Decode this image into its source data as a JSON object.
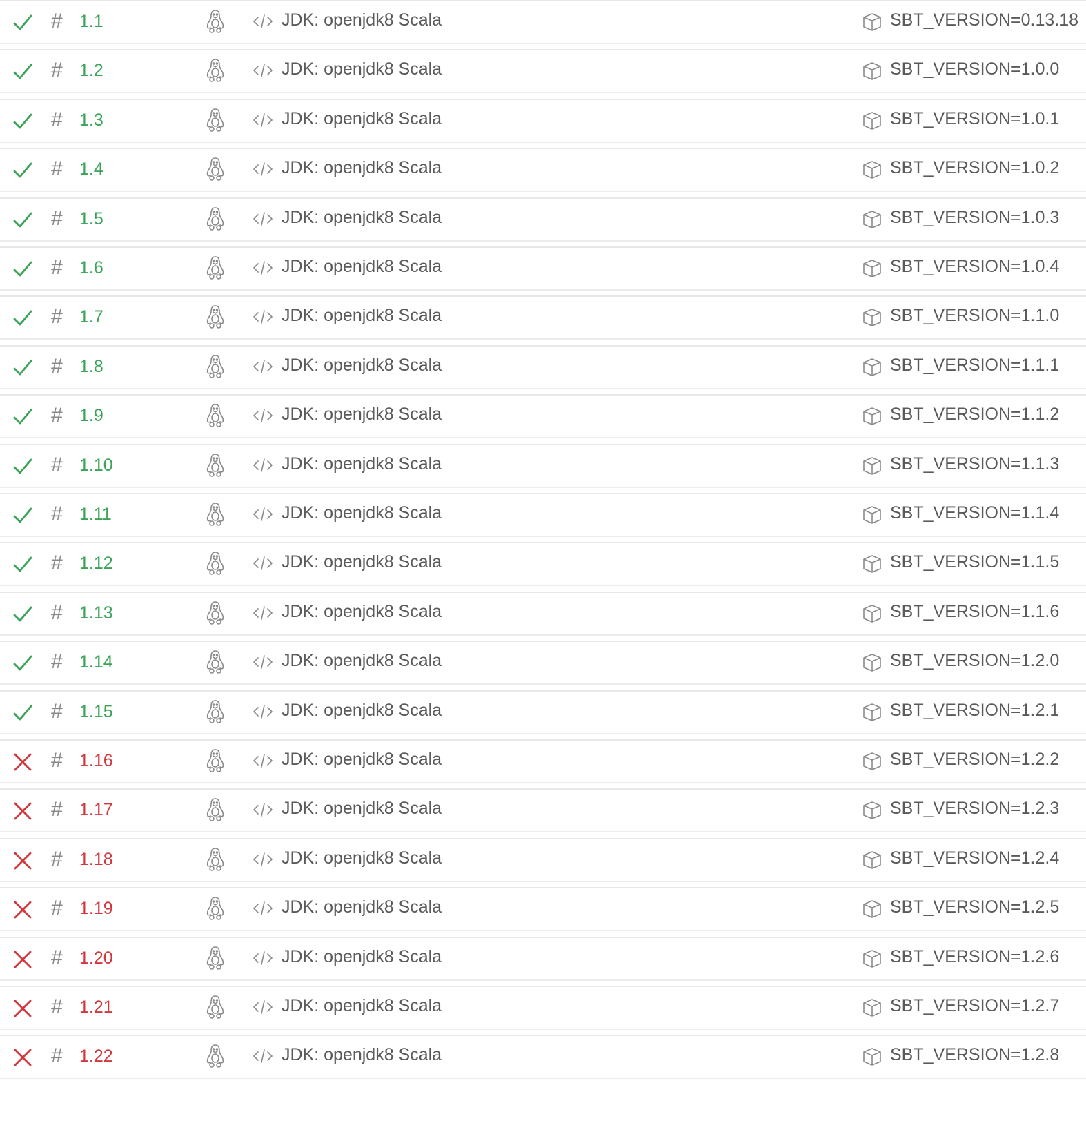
{
  "colors": {
    "passed": "#3aa357",
    "failed": "#d0383e",
    "text": "#5a5a5a",
    "icon": "#8a8a8a"
  },
  "icons": {
    "passed": "check-icon",
    "failed": "cross-icon",
    "number": "hash-icon",
    "os": "linux-penguin-icon",
    "language": "code-icon",
    "env": "package-cube-icon"
  },
  "jobs": [
    {
      "status": "passed",
      "hash": "#",
      "number": "1.1",
      "language": "JDK: openjdk8 Scala",
      "env": "SBT_VERSION=0.13.18"
    },
    {
      "status": "passed",
      "hash": "#",
      "number": "1.2",
      "language": "JDK: openjdk8 Scala",
      "env": "SBT_VERSION=1.0.0"
    },
    {
      "status": "passed",
      "hash": "#",
      "number": "1.3",
      "language": "JDK: openjdk8 Scala",
      "env": "SBT_VERSION=1.0.1"
    },
    {
      "status": "passed",
      "hash": "#",
      "number": "1.4",
      "language": "JDK: openjdk8 Scala",
      "env": "SBT_VERSION=1.0.2"
    },
    {
      "status": "passed",
      "hash": "#",
      "number": "1.5",
      "language": "JDK: openjdk8 Scala",
      "env": "SBT_VERSION=1.0.3"
    },
    {
      "status": "passed",
      "hash": "#",
      "number": "1.6",
      "language": "JDK: openjdk8 Scala",
      "env": "SBT_VERSION=1.0.4"
    },
    {
      "status": "passed",
      "hash": "#",
      "number": "1.7",
      "language": "JDK: openjdk8 Scala",
      "env": "SBT_VERSION=1.1.0"
    },
    {
      "status": "passed",
      "hash": "#",
      "number": "1.8",
      "language": "JDK: openjdk8 Scala",
      "env": "SBT_VERSION=1.1.1"
    },
    {
      "status": "passed",
      "hash": "#",
      "number": "1.9",
      "language": "JDK: openjdk8 Scala",
      "env": "SBT_VERSION=1.1.2"
    },
    {
      "status": "passed",
      "hash": "#",
      "number": "1.10",
      "language": "JDK: openjdk8 Scala",
      "env": "SBT_VERSION=1.1.3"
    },
    {
      "status": "passed",
      "hash": "#",
      "number": "1.11",
      "language": "JDK: openjdk8 Scala",
      "env": "SBT_VERSION=1.1.4"
    },
    {
      "status": "passed",
      "hash": "#",
      "number": "1.12",
      "language": "JDK: openjdk8 Scala",
      "env": "SBT_VERSION=1.1.5"
    },
    {
      "status": "passed",
      "hash": "#",
      "number": "1.13",
      "language": "JDK: openjdk8 Scala",
      "env": "SBT_VERSION=1.1.6"
    },
    {
      "status": "passed",
      "hash": "#",
      "number": "1.14",
      "language": "JDK: openjdk8 Scala",
      "env": "SBT_VERSION=1.2.0"
    },
    {
      "status": "passed",
      "hash": "#",
      "number": "1.15",
      "language": "JDK: openjdk8 Scala",
      "env": "SBT_VERSION=1.2.1"
    },
    {
      "status": "failed",
      "hash": "#",
      "number": "1.16",
      "language": "JDK: openjdk8 Scala",
      "env": "SBT_VERSION=1.2.2"
    },
    {
      "status": "failed",
      "hash": "#",
      "number": "1.17",
      "language": "JDK: openjdk8 Scala",
      "env": "SBT_VERSION=1.2.3"
    },
    {
      "status": "failed",
      "hash": "#",
      "number": "1.18",
      "language": "JDK: openjdk8 Scala",
      "env": "SBT_VERSION=1.2.4"
    },
    {
      "status": "failed",
      "hash": "#",
      "number": "1.19",
      "language": "JDK: openjdk8 Scala",
      "env": "SBT_VERSION=1.2.5"
    },
    {
      "status": "failed",
      "hash": "#",
      "number": "1.20",
      "language": "JDK: openjdk8 Scala",
      "env": "SBT_VERSION=1.2.6"
    },
    {
      "status": "failed",
      "hash": "#",
      "number": "1.21",
      "language": "JDK: openjdk8 Scala",
      "env": "SBT_VERSION=1.2.7"
    },
    {
      "status": "failed",
      "hash": "#",
      "number": "1.22",
      "language": "JDK: openjdk8 Scala",
      "env": "SBT_VERSION=1.2.8"
    }
  ]
}
